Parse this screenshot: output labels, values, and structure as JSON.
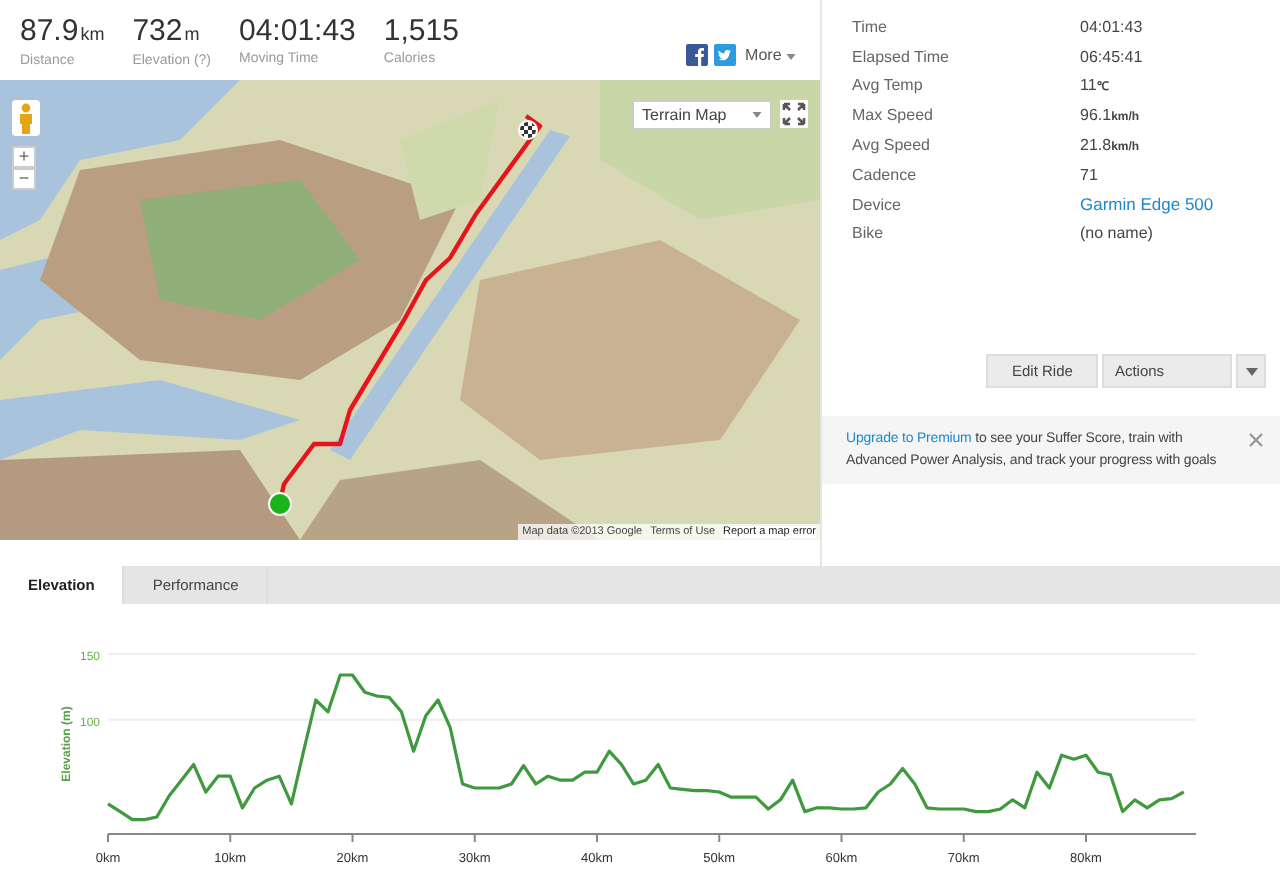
{
  "summary": [
    {
      "value": "87.9",
      "unit": "km",
      "label": "Distance"
    },
    {
      "value": "732",
      "unit": "m",
      "label": "Elevation (?)"
    },
    {
      "value": "04:01:43",
      "label": "Moving Time"
    },
    {
      "value": "1,515",
      "label": "Calories"
    }
  ],
  "share": {
    "more": "More"
  },
  "map": {
    "map_type": "Terrain Map",
    "zoom_in": "+",
    "zoom_out": "−",
    "attribution": "Map data ©2013 Google",
    "terms": "Terms of Use",
    "report": "Report a map error"
  },
  "details": [
    {
      "label": "Time",
      "value": "04:01:43",
      "kind": "text"
    },
    {
      "label": "Elapsed Time",
      "value": "06:45:41",
      "kind": "text"
    },
    {
      "label": "Avg Temp",
      "value": "11",
      "unit": "℃",
      "kind": "text"
    },
    {
      "label": "Max Speed",
      "value": "96.1",
      "unit": "km/h",
      "kind": "text"
    },
    {
      "label": "Avg Speed",
      "value": "21.8",
      "unit": "km/h",
      "kind": "text"
    },
    {
      "label": "Cadence",
      "value": "71",
      "kind": "text"
    },
    {
      "label": "Device",
      "value": "Garmin Edge 500",
      "kind": "link"
    },
    {
      "label": "Bike",
      "value": "(no name)",
      "kind": "text"
    }
  ],
  "buttons": {
    "edit": "Edit Ride",
    "actions": "Actions"
  },
  "upgrade": {
    "link": "Upgrade to Premium",
    "text": " to see your Suffer Score, train with Advanced Power Analysis, and track your progress with goals"
  },
  "tabs": [
    {
      "label": "Elevation",
      "selected": true
    },
    {
      "label": "Performance",
      "selected": false
    }
  ],
  "elevation": {
    "chart_data": {
      "type": "line",
      "ylabel": "Elevation (m)",
      "x": [
        0,
        1,
        2,
        3,
        4,
        5,
        6,
        7,
        8,
        9,
        10,
        11,
        12,
        13,
        14,
        15,
        16,
        17,
        18,
        19,
        20,
        21,
        22,
        23,
        24,
        25,
        26,
        27,
        28,
        29,
        30,
        31,
        32,
        33,
        34,
        35,
        36,
        37,
        38,
        39,
        40,
        41,
        42,
        43,
        44,
        45,
        46,
        47,
        48,
        49,
        50,
        51,
        52,
        53,
        54,
        55,
        56,
        57,
        58,
        59,
        60,
        61,
        62,
        63,
        64,
        65,
        66,
        67,
        68,
        69,
        70,
        71,
        72,
        73,
        74,
        75,
        76,
        77,
        78,
        79,
        80,
        81,
        82,
        83,
        84,
        85,
        86,
        87,
        88
      ],
      "series": [
        {
          "color": "#3f9a3f",
          "values": [
            36,
            30,
            24,
            24,
            26,
            42,
            54,
            66,
            45,
            57,
            57,
            33,
            48,
            54,
            57,
            36,
            76,
            115,
            106,
            134,
            134,
            121,
            118,
            117,
            106,
            76,
            103,
            115,
            94,
            51,
            48,
            48,
            48,
            51,
            65,
            51,
            57,
            54,
            54,
            60,
            60,
            76,
            66,
            51,
            54,
            66,
            48,
            47,
            46,
            46,
            45,
            41,
            41,
            41,
            32,
            39,
            54,
            30,
            33,
            33,
            32,
            32,
            33,
            45,
            51,
            63,
            51,
            33,
            32,
            32,
            32,
            30,
            30,
            32,
            39,
            33,
            60,
            48,
            73,
            70,
            73,
            60,
            58,
            30,
            39,
            33,
            39,
            40,
            45
          ]
        }
      ],
      "xlim": [
        0,
        89
      ],
      "ylim": [
        13,
        150
      ],
      "xticks": [
        {
          "value": 0,
          "label": "0km"
        },
        {
          "value": 10,
          "label": "10km"
        },
        {
          "value": 20,
          "label": "20km"
        },
        {
          "value": 30,
          "label": "30km"
        },
        {
          "value": 40,
          "label": "40km"
        },
        {
          "value": 50,
          "label": "50km"
        },
        {
          "value": 60,
          "label": "60km"
        },
        {
          "value": 70,
          "label": "70km"
        },
        {
          "value": 80,
          "label": "80km"
        }
      ],
      "yticks": [
        100,
        150
      ]
    }
  }
}
